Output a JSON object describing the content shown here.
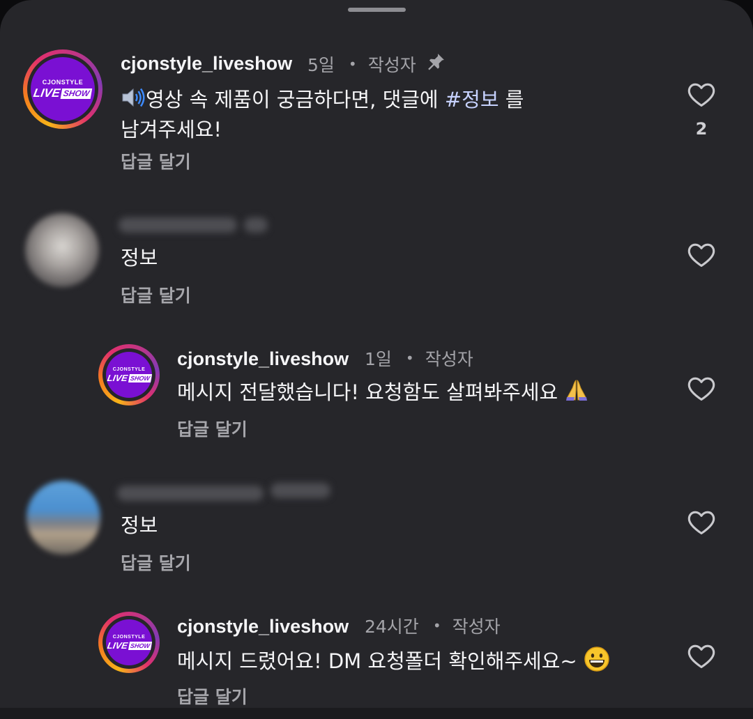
{
  "author_badge": "작성자",
  "reply_label": "답글 달기",
  "brand_logo": {
    "top": "CJONSTYLE",
    "live": "LIVE",
    "show": "SHOW"
  },
  "comments": [
    {
      "username": "cjonstyle_liveshow",
      "time": "5일",
      "author": true,
      "pinned": true,
      "text_parts": [
        "영상 속 제품이 궁금하다면, 댓글에 ",
        "#정보",
        " 를"
      ],
      "text_line2": "남겨주세요!",
      "likes": "2"
    },
    {
      "username": "",
      "time": "",
      "text": "정보"
    },
    {
      "username": "cjonstyle_liveshow",
      "time": "1일",
      "author": true,
      "text": "메시지 전달했습니다!  요청함도 살펴봐주세요 "
    },
    {
      "username": "",
      "time": "",
      "text": "정보"
    },
    {
      "username": "cjonstyle_liveshow",
      "time": "24시간",
      "author": true,
      "text": "메시지 드렸어요! DM 요청폴더 확인해주세요~ "
    }
  ],
  "icons": [
    "speaker-icon",
    "pin-icon",
    "heart-icon",
    "praying-hands-emoji",
    "grinning-face-emoji"
  ],
  "colors": {
    "background": "#26262a",
    "brand_purple": "#7a10d3",
    "muted_text": "#a4a4a9",
    "hashtag": "#c7d2ff"
  }
}
